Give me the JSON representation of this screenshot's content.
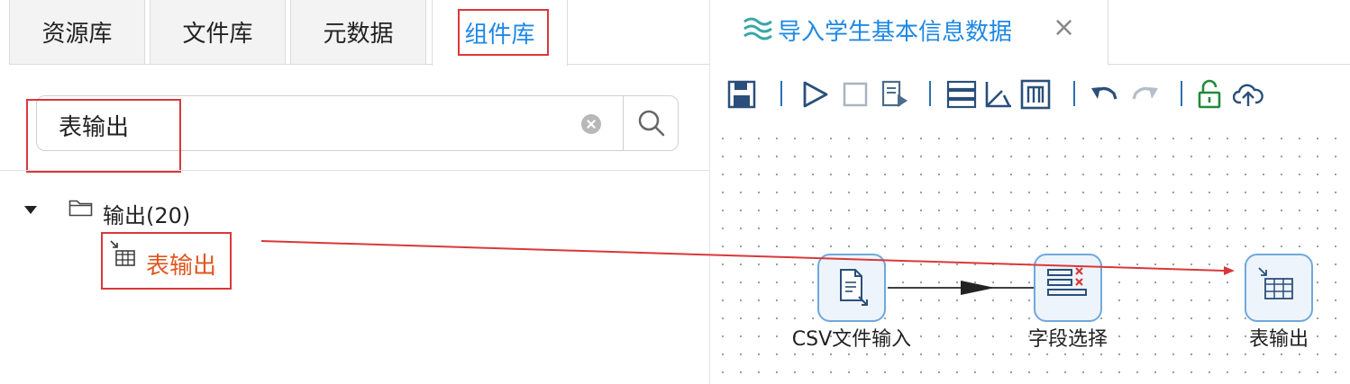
{
  "left_panel": {
    "tabs": [
      "资源库",
      "文件库",
      "元数据",
      "组件库"
    ],
    "active_tab": "组件库",
    "search": {
      "value": "表输出"
    },
    "tree": {
      "parent_label": "输出(20)",
      "child_label": "表输出"
    }
  },
  "editor": {
    "tab_title": "导入学生基本信息数据",
    "close_glyph": "×",
    "toolbar_icons": [
      "save-icon",
      "run-icon",
      "stop-icon",
      "preview-icon",
      "sql-icon",
      "explain-icon",
      "metadata-icon",
      "undo-icon",
      "redo-icon",
      "unlock-icon",
      "upload-icon"
    ],
    "nodes": [
      {
        "label": "CSV文件输入",
        "icon": "csv-file-input-icon"
      },
      {
        "label": "字段选择",
        "icon": "select-values-icon"
      },
      {
        "label": "表输出",
        "icon": "table-output-icon"
      }
    ]
  },
  "colors": {
    "accent": "#1e88e5",
    "highlight_box": "#d9383a",
    "tree_selected": "#e0571f",
    "node_border": "#6fa8dc"
  }
}
